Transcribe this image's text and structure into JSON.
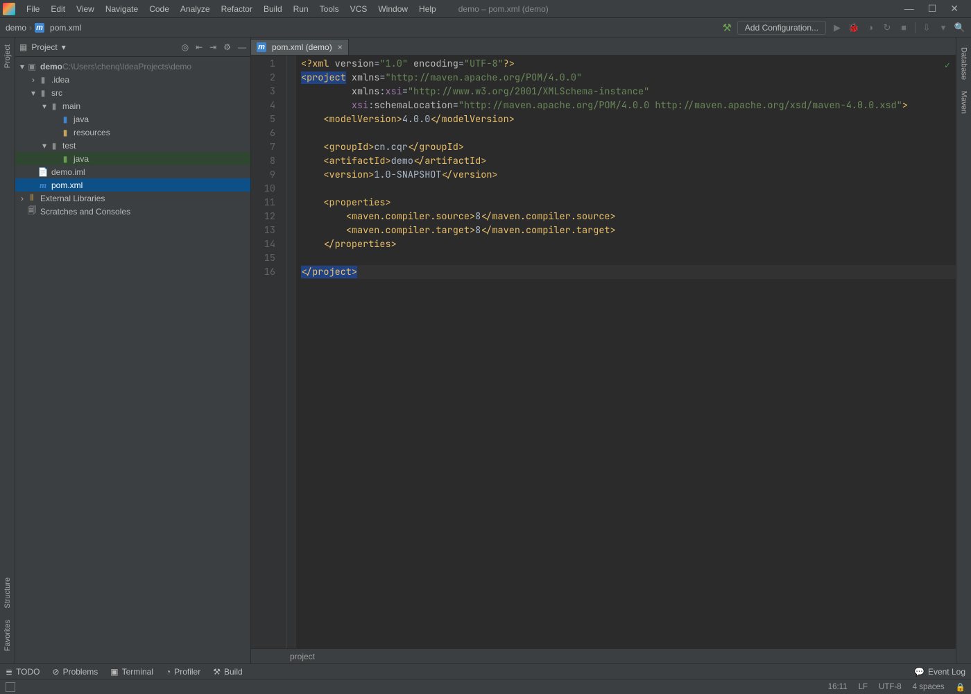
{
  "window": {
    "title": "demo – pom.xml (demo)",
    "minimize": "—",
    "maximize": "☐",
    "close": "✕"
  },
  "menu": {
    "file": "File",
    "edit": "Edit",
    "view": "View",
    "navigate": "Navigate",
    "code": "Code",
    "analyze": "Analyze",
    "refactor": "Refactor",
    "build": "Build",
    "run": "Run",
    "tools": "Tools",
    "vcs": "VCS",
    "window": "Window",
    "help": "Help"
  },
  "breadcrumb": {
    "project": "demo",
    "sep": "›",
    "file_icon": "m",
    "file": "pom.xml"
  },
  "toolbar": {
    "add_config": "Add Configuration...",
    "hammer": "⚒",
    "run": "▶",
    "debug": "🐞",
    "coverage": "◑",
    "profile": "↻",
    "stop": "■",
    "update": "⇩",
    "search": "🔍"
  },
  "projectPanel": {
    "title": "Project",
    "arrow": "▾",
    "actions": {
      "target": "◎",
      "collapse": "⇤",
      "settings": "⚙",
      "expand": "⇥",
      "hide": "—"
    }
  },
  "tree": {
    "root_name": "demo",
    "root_path": " C:\\Users\\chenq\\IdeaProjects\\demo",
    "idea": ".idea",
    "src": "src",
    "main": "main",
    "main_java": "java",
    "resources": "resources",
    "test": "test",
    "test_java": "java",
    "iml": "demo.iml",
    "pom_icon": "m",
    "pom": "pom.xml",
    "ext": "External Libraries",
    "scratch": "Scratches and Consoles"
  },
  "editor": {
    "tab_icon": "m",
    "tab_label": "pom.xml (demo)",
    "tab_close": "×",
    "lines": [
      "1",
      "2",
      "3",
      "4",
      "5",
      "6",
      "7",
      "8",
      "9",
      "10",
      "11",
      "12",
      "13",
      "14",
      "15",
      "16"
    ],
    "crumb": "project"
  },
  "xml": {
    "xml_decl_open": "<?xml",
    "version_attr": "version",
    "version_val": "\"1.0\"",
    "encoding_attr": "encoding",
    "encoding_val": "\"UTF-8\"",
    "pi_close": "?>",
    "project_open": "<project",
    "xmlns": "xmlns",
    "ns1_val": "\"http://maven.apache.org/POM/4.0.0\"",
    "xsi": "xsi",
    "ns2_val": "\"http://www.w3.org/2001/XMLSchema-instance\"",
    "schema": "schemaLocation",
    "schema_val": "\"http://maven.apache.org/POM/4.0.0 http://maven.apache.org/xsd/maven-4.0.0.xsd\"",
    "close_tag": ">",
    "modelVersion_o": "<modelVersion>",
    "modelVersion_v": "4.0.0",
    "modelVersion_c": "</modelVersion>",
    "groupId_o": "<groupId>",
    "groupId_v": "cn.cqr",
    "groupId_c": "</groupId>",
    "artifactId_o": "<artifactId>",
    "artifactId_v": "demo",
    "artifactId_c": "</artifactId>",
    "version_o": "<version>",
    "version_v": "1.0-SNAPSHOT",
    "version_c": "</version>",
    "props_o": "<properties>",
    "src_o": "<maven.compiler.source>",
    "src_v": "8",
    "src_c": "</maven.compiler.source>",
    "tgt_o": "<maven.compiler.target>",
    "tgt_v": "8",
    "tgt_c": "</maven.compiler.target>",
    "props_c": "</properties>",
    "project_c": "</project>"
  },
  "toolStripes": {
    "project": "Project",
    "structure": "Structure",
    "favorites": "Favorites",
    "database": "Database",
    "maven": "Maven"
  },
  "bottom": {
    "todo": "TODO",
    "problems": "Problems",
    "terminal": "Terminal",
    "profiler": "Profiler",
    "build": "Build",
    "eventlog": "Event Log"
  },
  "status": {
    "cursor": "16:11",
    "linesep": "LF",
    "encoding": "UTF-8",
    "indent": "4 spaces",
    "branch_icon": "⎇",
    "lock": "🔒"
  }
}
